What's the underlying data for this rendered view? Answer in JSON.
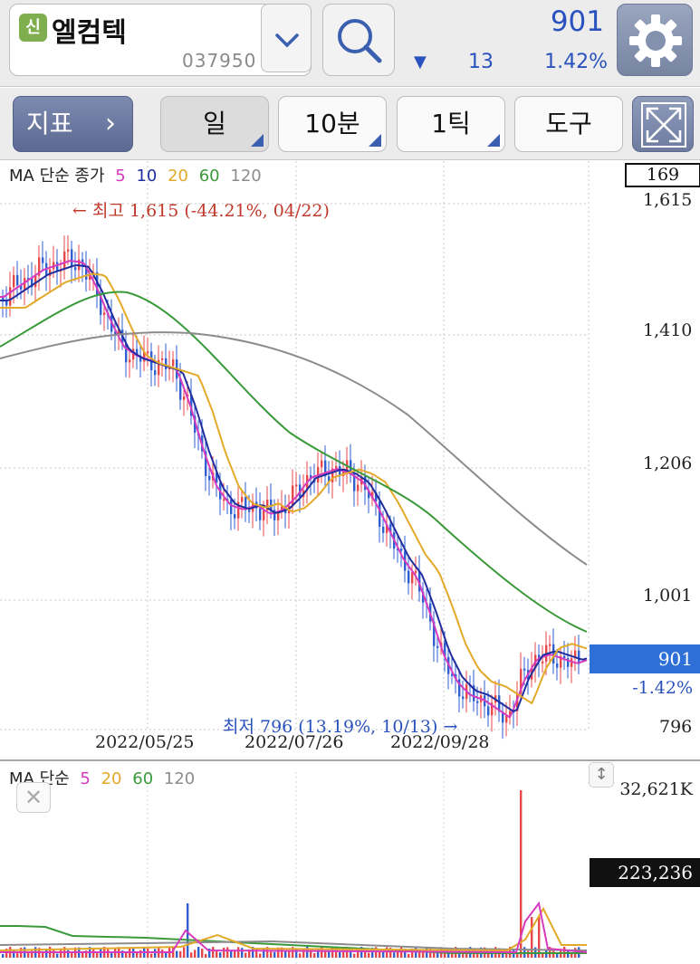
{
  "header": {
    "market_badge": "신",
    "stock_name": "엘컴텍",
    "stock_code": "037950",
    "price": "901",
    "change_arrow": "▼",
    "change_value": "13",
    "change_pct": "1.42%",
    "icons": {
      "dropdown": "chevron-down-icon",
      "search": "search-icon",
      "settings": "gear-icon"
    }
  },
  "toolbar": {
    "indicator": "지표",
    "indicator_chevron": "›",
    "period_day": "일",
    "period_min": "10분",
    "period_tick": "1틱",
    "tools": "도구",
    "expand_icon": "expand-icon"
  },
  "price_chart": {
    "ma_label": "MA 단순 종가",
    "ma_periods": [
      "5",
      "10",
      "20",
      "60",
      "120"
    ],
    "count": "169",
    "y_ticks": [
      "1,615",
      "1,410",
      "1,206",
      "1,001",
      "796"
    ],
    "current_price": "901",
    "current_pct": "-1.42%",
    "high_annotation": "← 최고 1,615 (-44.21%, 04/22)",
    "low_annotation": "최저 796 (13.19%, 10/13) →",
    "dates": [
      "2022/05/25",
      "2022/07/26",
      "2022/09/28"
    ]
  },
  "volume_chart": {
    "ma_label": "MA 단순",
    "ma_periods": [
      "5",
      "20",
      "60",
      "120"
    ],
    "max_label": "32,621K",
    "current_volume": "223,236"
  },
  "colors": {
    "ma5": "#d63bbf",
    "ma10": "#1f2d9e",
    "ma20": "#e3a928",
    "ma60": "#3a9a3a",
    "ma120": "#8c8c8c",
    "up": "#e8474a",
    "down": "#2f5fd0"
  }
}
